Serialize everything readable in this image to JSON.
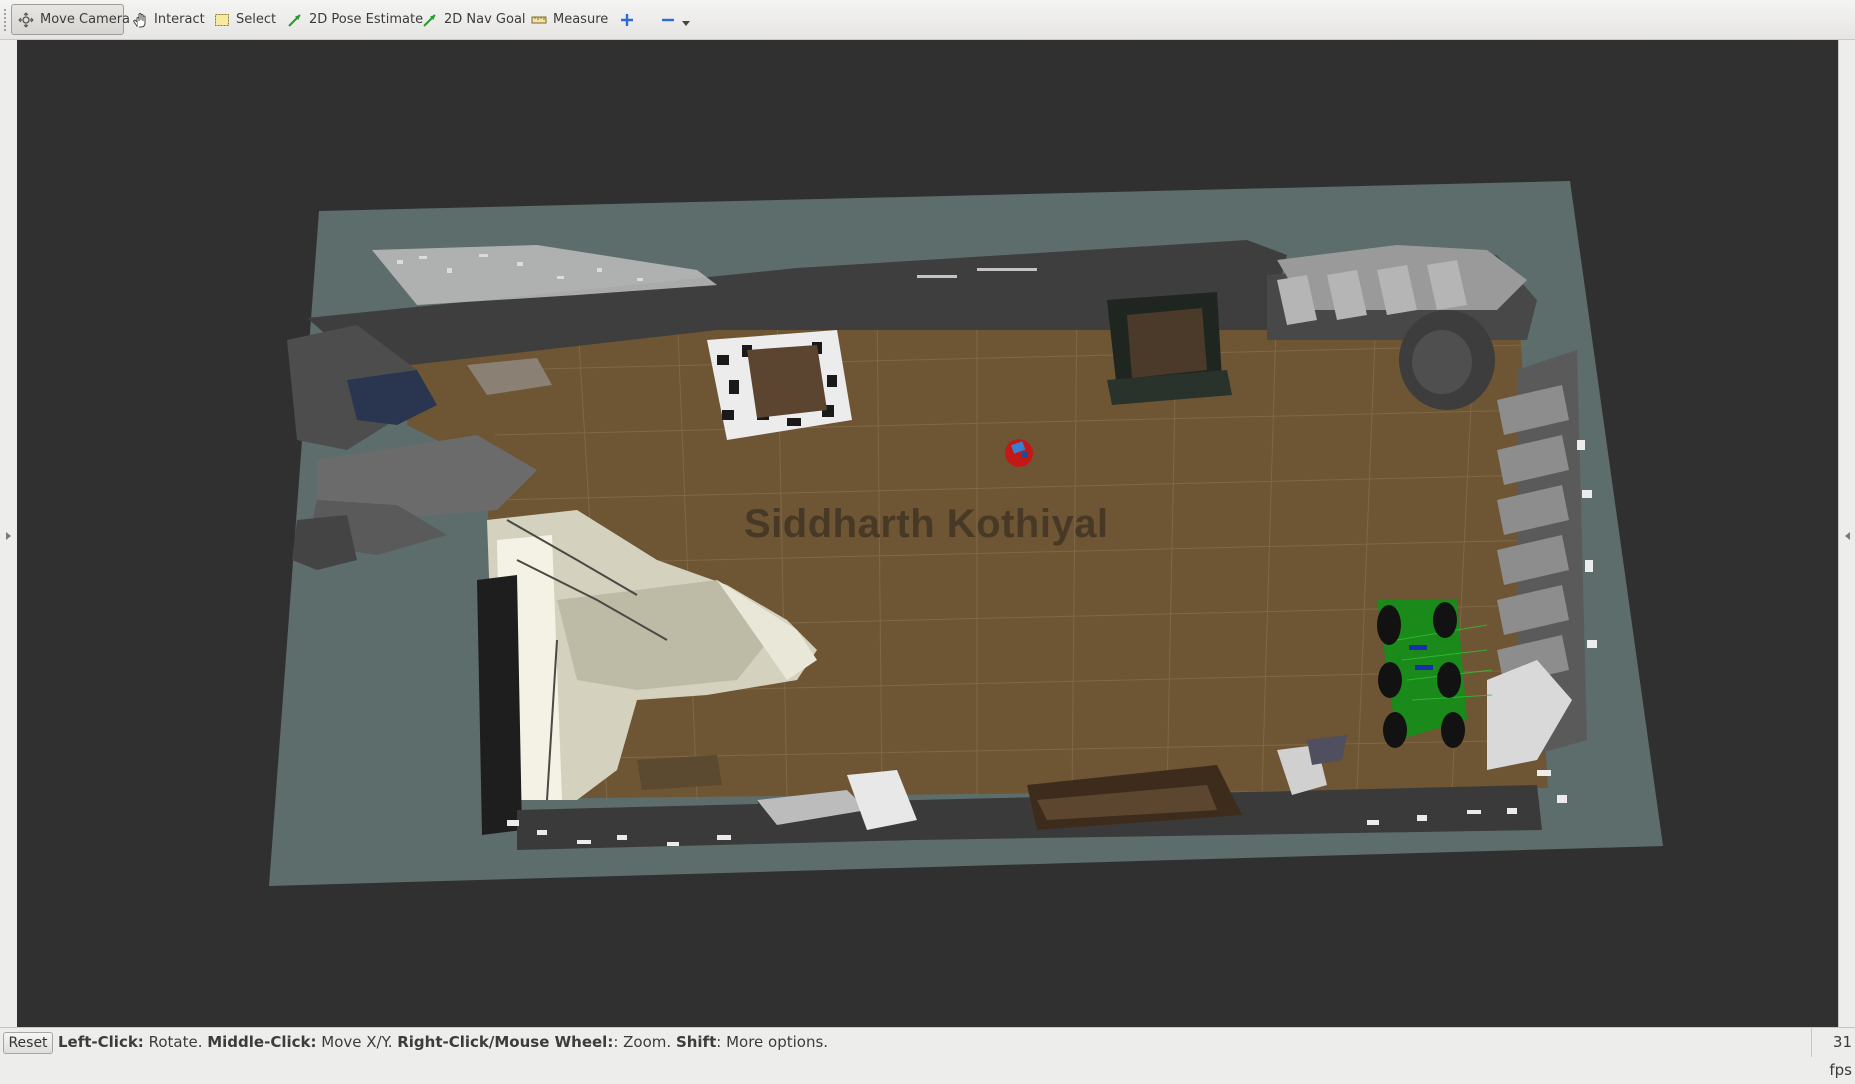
{
  "toolbar": {
    "tools": [
      {
        "id": "move-camera",
        "label": "Move Camera",
        "icon": "move-camera-icon",
        "active": true
      },
      {
        "id": "interact",
        "label": "Interact",
        "icon": "hand-icon",
        "active": false
      },
      {
        "id": "select",
        "label": "Select",
        "icon": "select-box-icon",
        "active": false
      },
      {
        "id": "pose-estimate",
        "label": "2D Pose Estimate",
        "icon": "green-arrow-icon",
        "active": false
      },
      {
        "id": "nav-goal",
        "label": "2D Nav Goal",
        "icon": "green-arrow-icon",
        "active": false
      },
      {
        "id": "measure",
        "label": "Measure",
        "icon": "ruler-icon",
        "active": false
      }
    ],
    "add_tool_icon": "plus-icon",
    "remove_tool_icon": "minus-icon",
    "menu_icon": "dropdown-arrow-icon"
  },
  "viewport": {
    "watermark": "Siddharth Kothiyal",
    "background_color": "#303030",
    "ground_plane_color": "#5d6d6c",
    "floor_color": "#6e5533"
  },
  "statusbar": {
    "reset_label": "Reset",
    "hint_parts": [
      {
        "bold": true,
        "text": "Left-Click:"
      },
      {
        "bold": false,
        "text": " Rotate. "
      },
      {
        "bold": true,
        "text": "Middle-Click:"
      },
      {
        "bold": false,
        "text": " Move X/Y. "
      },
      {
        "bold": true,
        "text": "Right-Click/Mouse Wheel:"
      },
      {
        "bold": false,
        "text": ": Zoom. "
      },
      {
        "bold": true,
        "text": "Shift"
      },
      {
        "bold": false,
        "text": ": More options."
      }
    ],
    "fps": "31 fps"
  }
}
